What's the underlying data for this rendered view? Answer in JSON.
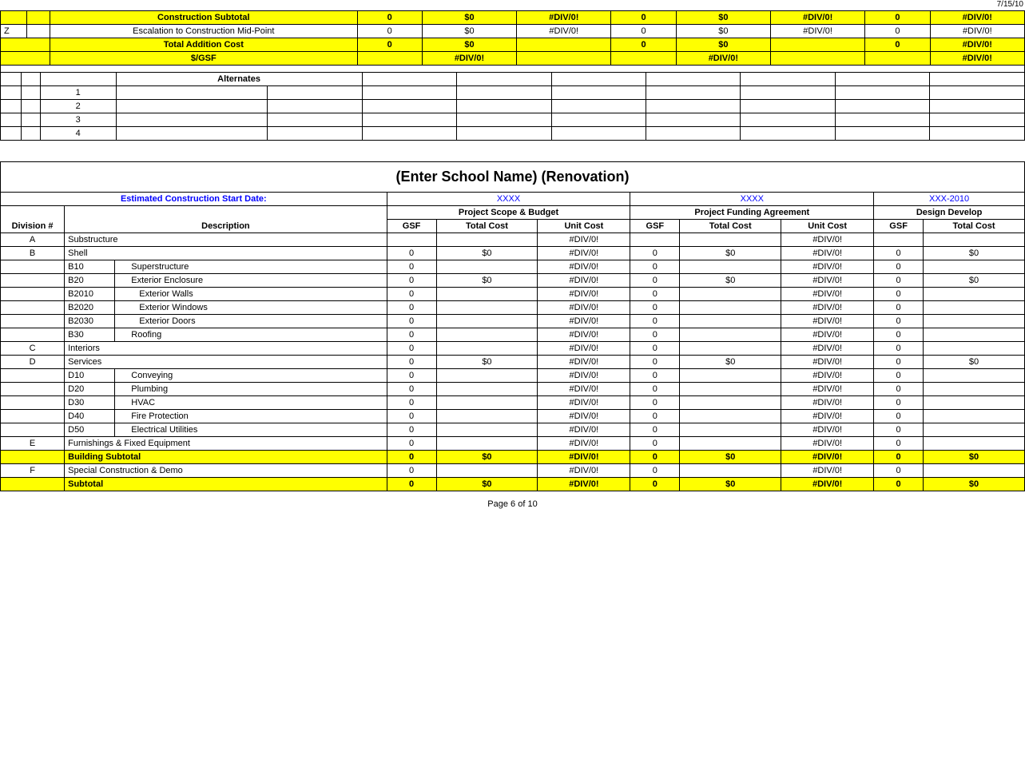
{
  "page": {
    "date_stamp": "7/15/10",
    "footer": "Page 6 of 10"
  },
  "top_table": {
    "construction_subtotal": {
      "label": "Construction Subtotal",
      "gsf1": "0",
      "total1": "$0",
      "unit1": "#DIV/0!",
      "gsf2": "0",
      "total2": "$0",
      "unit2": "#DIV/0!",
      "gsf3": "0",
      "unit3": "#DIV/0!"
    },
    "escalation": {
      "row_letter": "Z",
      "label": "Escalation to Construction Mid-Point",
      "gsf1": "0",
      "total1": "$0",
      "unit1": "#DIV/0!",
      "gsf2": "0",
      "total2": "$0",
      "unit2": "#DIV/0!",
      "gsf3": "0",
      "unit3": "#DIV/0!"
    },
    "total_addition": {
      "label": "Total Addition Cost",
      "gsf1": "0",
      "total1": "$0",
      "gsf2": "0",
      "total2": "$0",
      "gsf3": "0",
      "unit3": "#DIV/0!"
    },
    "gsf_row": {
      "label": "$/GSF",
      "unit1": "#DIV/0!",
      "unit2": "#DIV/0!",
      "unit3": "#DIV/0!"
    }
  },
  "alternates_table": {
    "header": "Alternates",
    "rows": [
      {
        "num": "1"
      },
      {
        "num": "2"
      },
      {
        "num": "3"
      },
      {
        "num": "4"
      }
    ]
  },
  "renovation_section": {
    "title": "(Enter School Name) (Renovation)",
    "est_start_label": "Estimated Construction Start Date:",
    "col1_code": "XXXX",
    "col2_code": "XXXX",
    "col3_code": "XXX-2010",
    "col1_label": "Project Scope & Budget",
    "col2_label": "Project Funding Agreement",
    "col3_label": "Design Develop",
    "sub_headers": {
      "gsf": "GSF",
      "total_cost": "Total Cost",
      "unit_cost": "Unit Cost"
    },
    "rows": [
      {
        "letter": "A",
        "code": "",
        "desc": "Substructure",
        "g1": "",
        "t1": "",
        "u1": "#DIV/0!",
        "g2": "",
        "t2": "",
        "u2": "#DIV/0!",
        "g3": "",
        "t3": ""
      },
      {
        "letter": "B",
        "code": "",
        "desc": "Shell",
        "g1": "0",
        "t1": "$0",
        "u1": "#DIV/0!",
        "g2": "0",
        "t2": "$0",
        "u2": "#DIV/0!",
        "g3": "0",
        "t3": "$0"
      },
      {
        "letter": "",
        "code": "B10",
        "desc": "Superstructure",
        "g1": "0",
        "t1": "",
        "u1": "#DIV/0!",
        "g2": "0",
        "t2": "",
        "u2": "#DIV/0!",
        "g3": "0",
        "t3": ""
      },
      {
        "letter": "",
        "code": "B20",
        "desc": "Exterior Enclosure",
        "g1": "0",
        "t1": "$0",
        "u1": "#DIV/0!",
        "g2": "0",
        "t2": "$0",
        "u2": "#DIV/0!",
        "g3": "0",
        "t3": "$0"
      },
      {
        "letter": "",
        "code": "B2010",
        "desc": "Exterior Walls",
        "g1": "0",
        "t1": "",
        "u1": "#DIV/0!",
        "g2": "0",
        "t2": "",
        "u2": "#DIV/0!",
        "g3": "0",
        "t3": ""
      },
      {
        "letter": "",
        "code": "B2020",
        "desc": "Exterior Windows",
        "g1": "0",
        "t1": "",
        "u1": "#DIV/0!",
        "g2": "0",
        "t2": "",
        "u2": "#DIV/0!",
        "g3": "0",
        "t3": ""
      },
      {
        "letter": "",
        "code": "B2030",
        "desc": "Exterior Doors",
        "g1": "0",
        "t1": "",
        "u1": "#DIV/0!",
        "g2": "0",
        "t2": "",
        "u2": "#DIV/0!",
        "g3": "0",
        "t3": ""
      },
      {
        "letter": "",
        "code": "B30",
        "desc": "Roofing",
        "g1": "0",
        "t1": "",
        "u1": "#DIV/0!",
        "g2": "0",
        "t2": "",
        "u2": "#DIV/0!",
        "g3": "0",
        "t3": ""
      },
      {
        "letter": "C",
        "code": "",
        "desc": "Interiors",
        "g1": "0",
        "t1": "",
        "u1": "#DIV/0!",
        "g2": "0",
        "t2": "",
        "u2": "#DIV/0!",
        "g3": "0",
        "t3": ""
      },
      {
        "letter": "D",
        "code": "",
        "desc": "Services",
        "g1": "0",
        "t1": "$0",
        "u1": "#DIV/0!",
        "g2": "0",
        "t2": "$0",
        "u2": "#DIV/0!",
        "g3": "0",
        "t3": "$0"
      },
      {
        "letter": "",
        "code": "D10",
        "desc": "Conveying",
        "g1": "0",
        "t1": "",
        "u1": "#DIV/0!",
        "g2": "0",
        "t2": "",
        "u2": "#DIV/0!",
        "g3": "0",
        "t3": ""
      },
      {
        "letter": "",
        "code": "D20",
        "desc": "Plumbing",
        "g1": "0",
        "t1": "",
        "u1": "#DIV/0!",
        "g2": "0",
        "t2": "",
        "u2": "#DIV/0!",
        "g3": "0",
        "t3": ""
      },
      {
        "letter": "",
        "code": "D30",
        "desc": "HVAC",
        "g1": "0",
        "t1": "",
        "u1": "#DIV/0!",
        "g2": "0",
        "t2": "",
        "u2": "#DIV/0!",
        "g3": "0",
        "t3": ""
      },
      {
        "letter": "",
        "code": "D40",
        "desc": "Fire Protection",
        "g1": "0",
        "t1": "",
        "u1": "#DIV/0!",
        "g2": "0",
        "t2": "",
        "u2": "#DIV/0!",
        "g3": "0",
        "t3": ""
      },
      {
        "letter": "",
        "code": "D50",
        "desc": "Electrical Utilities",
        "g1": "0",
        "t1": "",
        "u1": "#DIV/0!",
        "g2": "0",
        "t2": "",
        "u2": "#DIV/0!",
        "g3": "0",
        "t3": ""
      },
      {
        "letter": "E",
        "code": "",
        "desc": "Furnishings & Fixed Equipment",
        "g1": "0",
        "t1": "",
        "u1": "#DIV/0!",
        "g2": "0",
        "t2": "",
        "u2": "#DIV/0!",
        "g3": "0",
        "t3": ""
      }
    ],
    "building_subtotal": {
      "label": "Building Subtotal",
      "g1": "0",
      "t1": "$0",
      "u1": "#DIV/0!",
      "g2": "0",
      "t2": "$0",
      "u2": "#DIV/0!",
      "g3": "0",
      "t3": "$0"
    },
    "special_construction": {
      "letter": "F",
      "desc": "Special Construction & Demo",
      "g1": "0",
      "t1": "",
      "u1": "#DIV/0!",
      "g2": "0",
      "t2": "",
      "u2": "#DIV/0!",
      "g3": "0",
      "t3": ""
    },
    "subtotal_row": {
      "label": "Subtotal",
      "g1": "0",
      "t1": "$0",
      "u1": "#DIV/0!",
      "g2": "0",
      "t2": "$0",
      "u2": "#DIV/0!",
      "g3": "0",
      "t3": "$0"
    }
  }
}
